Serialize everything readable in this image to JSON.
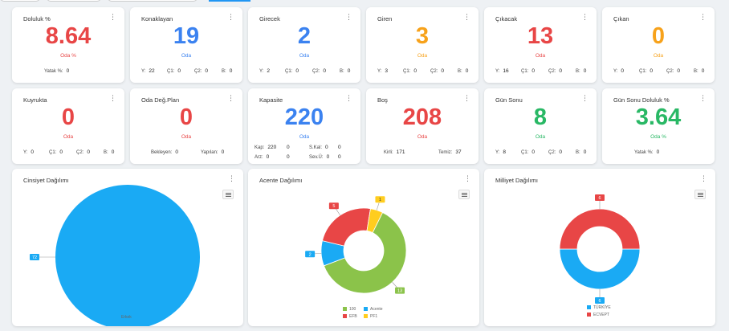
{
  "colors": {
    "red": "#e84646",
    "blue": "#3b82f0",
    "orange": "#f7a21b",
    "green": "#29b865",
    "cyan": "#1aaaf4",
    "lime": "#8bc34a",
    "yellow": "#ffcd1f"
  },
  "cards": [
    {
      "id": "doluluk",
      "title": "Doluluk %",
      "value": "8.64",
      "unit": "Oda %",
      "color": "red",
      "menu": "⋮",
      "mini": [
        {
          "label": "Yatak %",
          "value": "0"
        }
      ]
    },
    {
      "id": "konaklayan",
      "title": "Konaklayan",
      "value": "19",
      "unit": "Oda",
      "color": "blue",
      "menu": "⋮",
      "mini": [
        {
          "label": "Y",
          "value": "22"
        },
        {
          "label": "Ç1",
          "value": "0"
        },
        {
          "label": "Ç2",
          "value": "0"
        },
        {
          "label": "B",
          "value": "0"
        }
      ]
    },
    {
      "id": "girecek",
      "title": "Girecek",
      "value": "2",
      "unit": "Oda",
      "color": "blue",
      "menu": "⋮",
      "mini": [
        {
          "label": "Y",
          "value": "2"
        },
        {
          "label": "Ç1",
          "value": "0"
        },
        {
          "label": "Ç2",
          "value": "0"
        },
        {
          "label": "B",
          "value": "0"
        }
      ]
    },
    {
      "id": "giren",
      "title": "Giren",
      "value": "3",
      "unit": "Oda",
      "color": "orange",
      "menu": "⋮",
      "mini": [
        {
          "label": "Y",
          "value": "3"
        },
        {
          "label": "Ç1",
          "value": "0"
        },
        {
          "label": "Ç2",
          "value": "0"
        },
        {
          "label": "B",
          "value": "0"
        }
      ]
    },
    {
      "id": "cikacak",
      "title": "Çıkacak",
      "value": "13",
      "unit": "Oda",
      "color": "red",
      "menu": "⋮",
      "mini": [
        {
          "label": "Y",
          "value": "16"
        },
        {
          "label": "Ç1",
          "value": "0"
        },
        {
          "label": "Ç2",
          "value": "0"
        },
        {
          "label": "B",
          "value": "0"
        }
      ]
    },
    {
      "id": "cikan",
      "title": "Çıkan",
      "value": "0",
      "unit": "Oda",
      "color": "orange",
      "menu": "⋮",
      "mini": [
        {
          "label": "Y",
          "value": "0"
        },
        {
          "label": "Ç1",
          "value": "0"
        },
        {
          "label": "Ç2",
          "value": "0"
        },
        {
          "label": "B",
          "value": "0"
        }
      ]
    },
    {
      "id": "kuyrukta",
      "title": "Kuyrukta",
      "value": "0",
      "unit": "Oda",
      "color": "red",
      "menu": "⋮",
      "mini": [
        {
          "label": "Y",
          "value": "0"
        },
        {
          "label": "Ç1",
          "value": "0"
        },
        {
          "label": "Ç2",
          "value": "0"
        },
        {
          "label": "B",
          "value": "0"
        }
      ]
    },
    {
      "id": "odadegplan",
      "title": "Oda Değ.Plan",
      "value": "0",
      "unit": "Oda",
      "color": "red",
      "menu": "⋮",
      "mini": [
        {
          "label": "Bekleyen",
          "value": "0"
        },
        {
          "label": "Yapılan",
          "value": "0"
        }
      ]
    },
    {
      "id": "kapasite",
      "title": "Kapasite",
      "value": "220",
      "unit": "Oda",
      "color": "blue",
      "menu": "⋮",
      "mini": [
        {
          "label": "Kap",
          "value": "220"
        },
        {
          "label": "",
          "value": "0"
        },
        {
          "label": "S.Kal",
          "value": "0"
        },
        {
          "label": "",
          "value": "0"
        },
        {
          "label": "Arz",
          "value": "0"
        },
        {
          "label": "",
          "value": "0"
        },
        {
          "label": "Sev.Ü",
          "value": "0"
        },
        {
          "label": "",
          "value": "0"
        }
      ]
    },
    {
      "id": "bos",
      "title": "Boş",
      "value": "208",
      "unit": "Oda",
      "color": "red",
      "menu": "⋮",
      "mini": [
        {
          "label": "Kirli",
          "value": "171"
        },
        {
          "label": "Temiz",
          "value": "37"
        }
      ]
    },
    {
      "id": "gunsonu",
      "title": "Gün Sonu",
      "value": "8",
      "unit": "Oda",
      "color": "green",
      "menu": "⋮",
      "mini": [
        {
          "label": "Y",
          "value": "8"
        },
        {
          "label": "Ç1",
          "value": "0"
        },
        {
          "label": "Ç2",
          "value": "0"
        },
        {
          "label": "B",
          "value": "0"
        }
      ]
    },
    {
      "id": "gunsonudoluluk",
      "title": "Gün Sonu Doluluk %",
      "value": "3.64",
      "unit": "Oda %",
      "color": "green",
      "menu": "⋮",
      "mini": [
        {
          "label": "Yatak %",
          "value": "0"
        }
      ]
    }
  ],
  "panels": [
    {
      "id": "cinsiyet",
      "title": "Cinsiyet Dağılımı",
      "menu": "⋮"
    },
    {
      "id": "acente",
      "title": "Acente Dağılımı",
      "menu": "⋮"
    },
    {
      "id": "milliyet",
      "title": "Milliyet Dağılımı",
      "menu": "⋮"
    }
  ],
  "chart_data": [
    {
      "type": "pie",
      "categories": [
        "Erkek"
      ],
      "values": [
        72
      ],
      "colors": [
        "#1aaaf4"
      ],
      "legend": "bottom"
    },
    {
      "type": "pie",
      "donut": true,
      "categories": [
        "100",
        "Acente",
        "EFB",
        "PF1"
      ],
      "values": [
        13,
        2,
        5,
        1
      ],
      "colors": [
        "#8bc34a",
        "#1aaaf4",
        "#e84646",
        "#ffcd1f"
      ],
      "legend": "bottom"
    },
    {
      "type": "pie",
      "donut": true,
      "categories": [
        "TÜRKİYE",
        "ECVEPT"
      ],
      "values": [
        6,
        6
      ],
      "colors": [
        "#1aaaf4",
        "#e84646"
      ],
      "legend": "bottom"
    }
  ]
}
